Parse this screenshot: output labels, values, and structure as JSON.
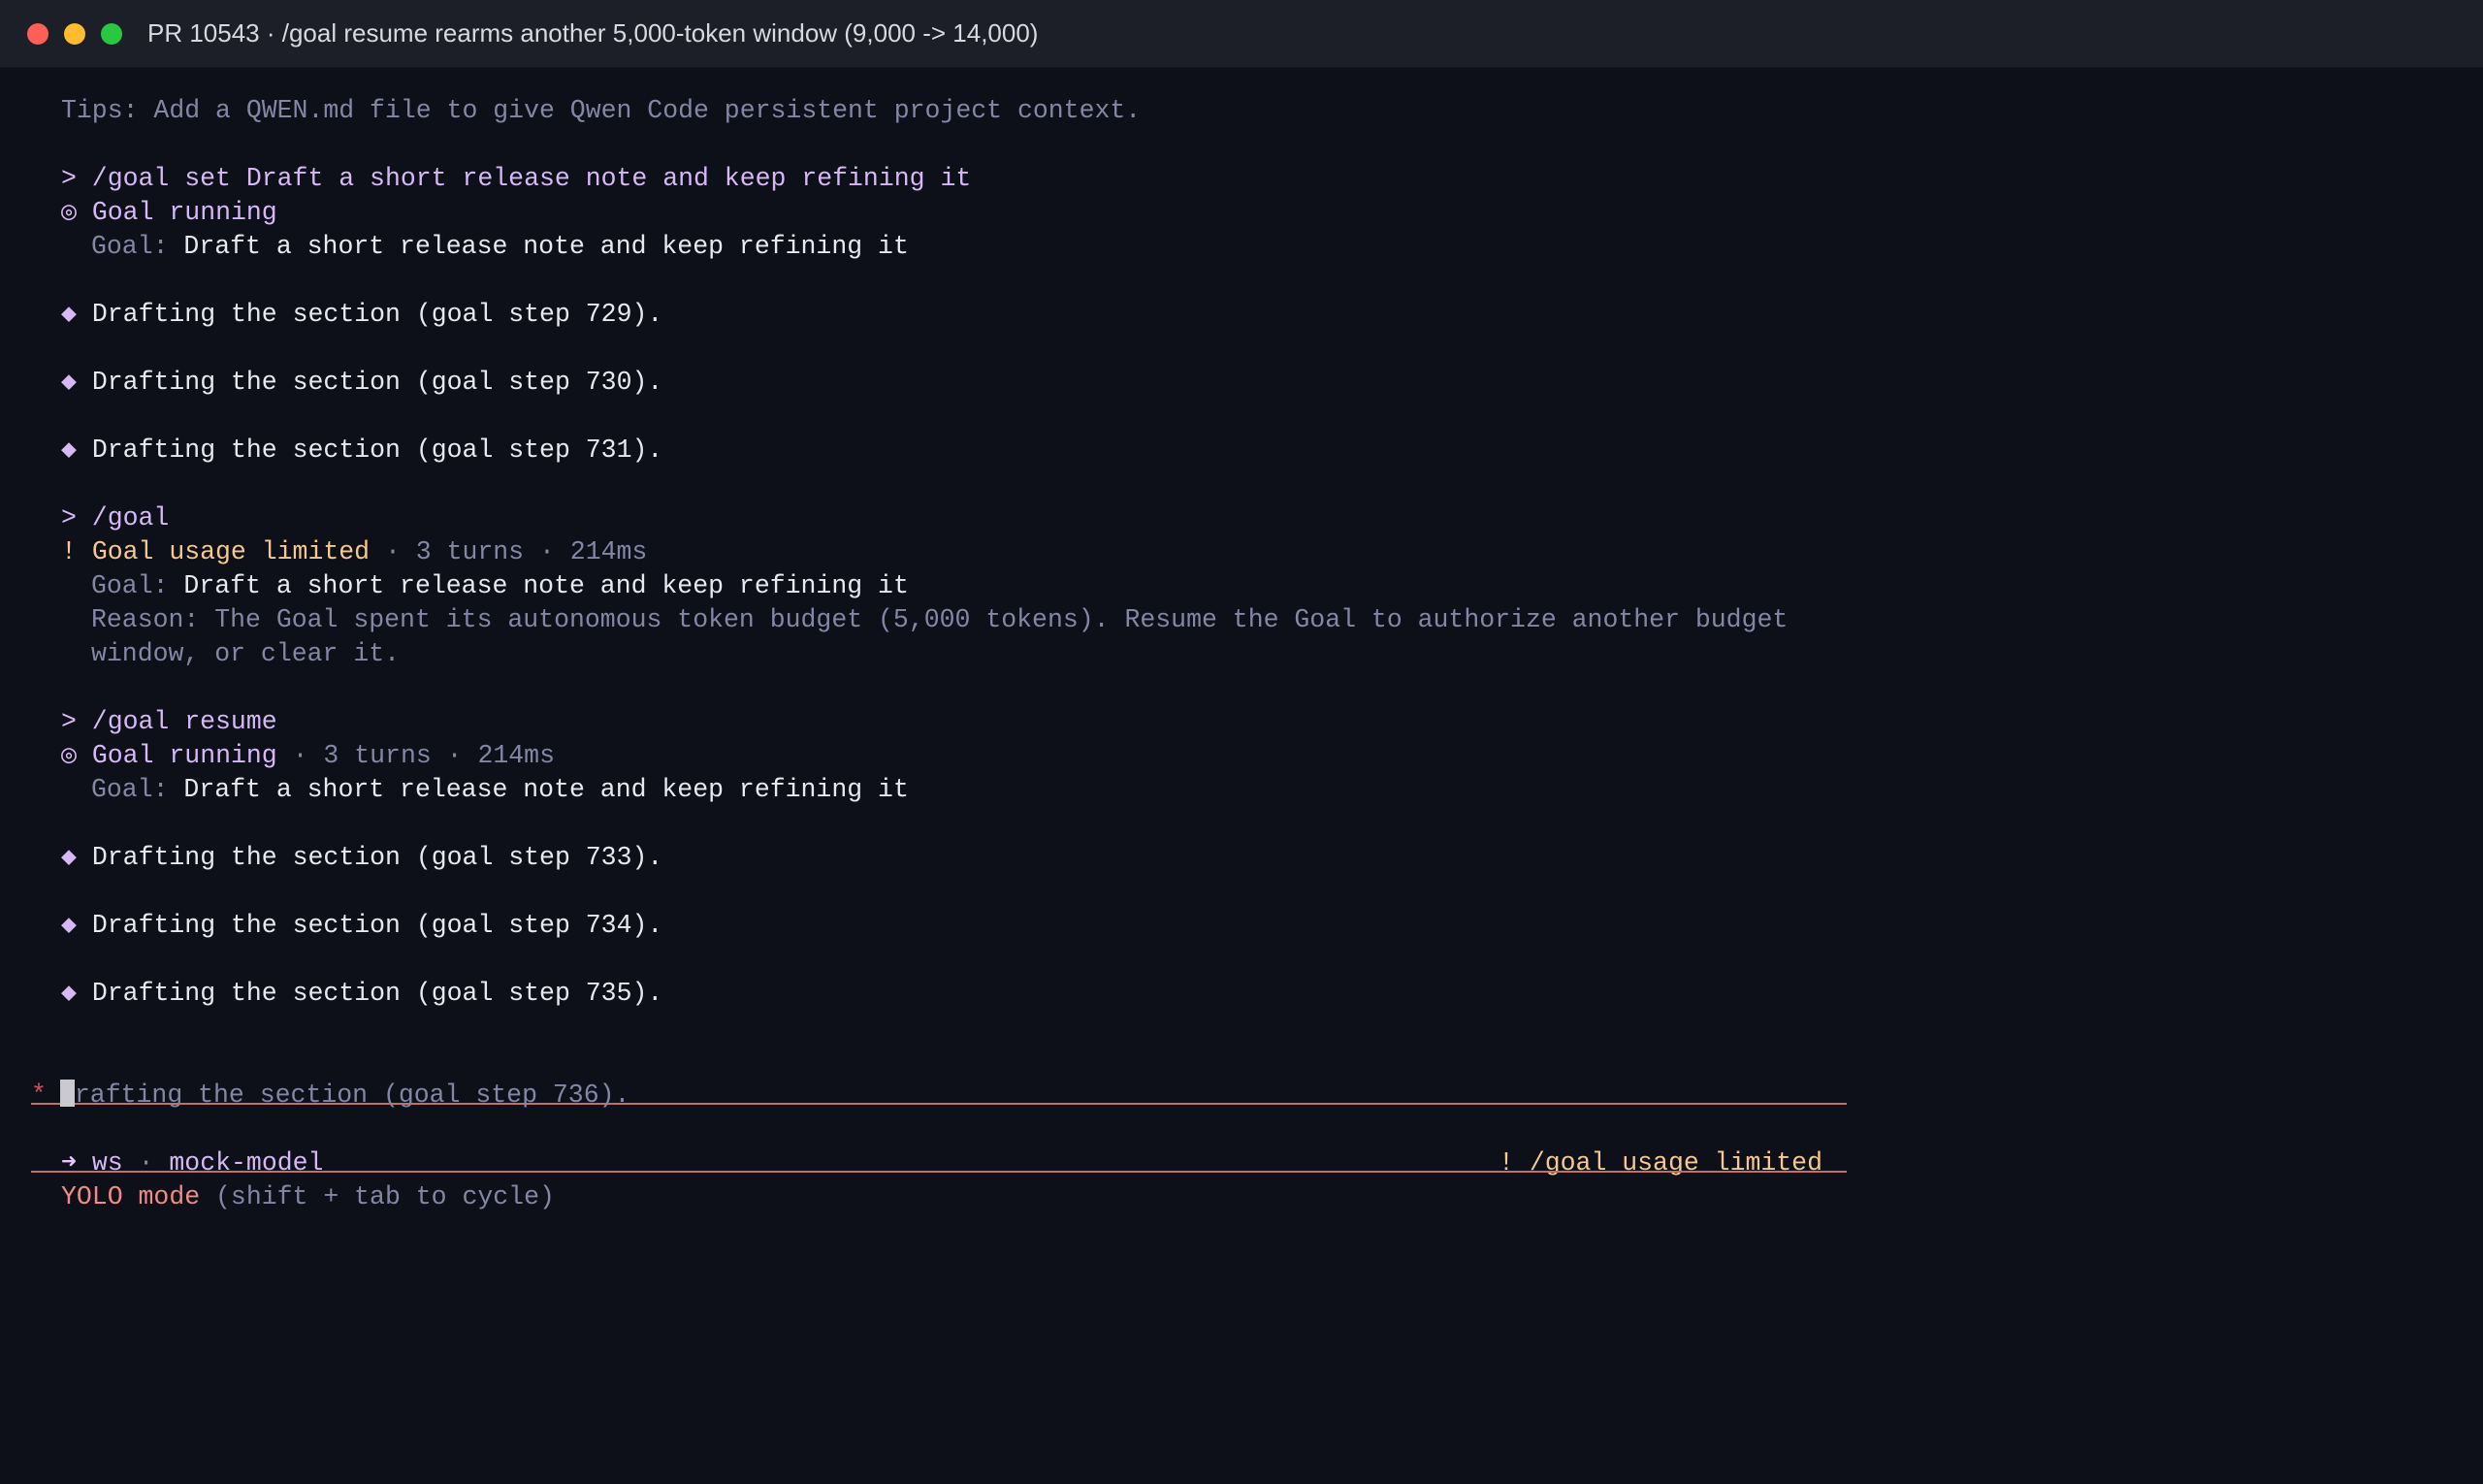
{
  "window": {
    "title": "PR 10543 · /goal resume rearms another 5,000-token window (9,000 -> 14,000)"
  },
  "tips": "Tips: Add a QWEN.md file to give Qwen Code persistent project context.",
  "block1": {
    "command": "> /goal set Draft a short release note and keep refining it",
    "status_symbol": "◎",
    "status": "Goal running",
    "goal_label": "Goal:",
    "goal_text": "Draft a short release note and keep refining it",
    "steps": [
      "Drafting the section (goal step 729).",
      "Drafting the section (goal step 730).",
      "Drafting the section (goal step 731)."
    ]
  },
  "block2": {
    "command": "> /goal",
    "status_symbol": "!",
    "status": "Goal usage limited",
    "meta": " · 3 turns · 214ms",
    "goal_label": "Goal:",
    "goal_text": "Draft a short release note and keep refining it",
    "reason_line1": "Reason: The Goal spent its autonomous token budget (5,000 tokens). Resume the Goal to authorize another budget",
    "reason_line2": "window, or clear it."
  },
  "block3": {
    "command": "> /goal resume",
    "status_symbol": "◎",
    "status": "Goal running",
    "meta": " · 3 turns · 214ms",
    "goal_label": "Goal:",
    "goal_text": "Draft a short release note and keep refining it",
    "steps": [
      "Drafting the section (goal step 733).",
      "Drafting the section (goal step 734).",
      "Drafting the section (goal step 735)."
    ]
  },
  "step_bullet": "◆",
  "input": {
    "prompt_symbol": "*",
    "placeholder_text": "rafting the section (goal step 736)."
  },
  "footer": {
    "arrow": "➜",
    "workspace": "ws",
    "separator": " · ",
    "model": "mock-model",
    "warning": "! /goal usage limited",
    "mode": "YOLO mode",
    "mode_hint": " (shift + tab to cycle)"
  },
  "colors": {
    "background": "#0e1019",
    "titlebar": "#1d1f28",
    "accent": "#d6b8f5",
    "warning": "#f4c88e",
    "mode": "#f08a84",
    "rule": "#c46f66"
  }
}
